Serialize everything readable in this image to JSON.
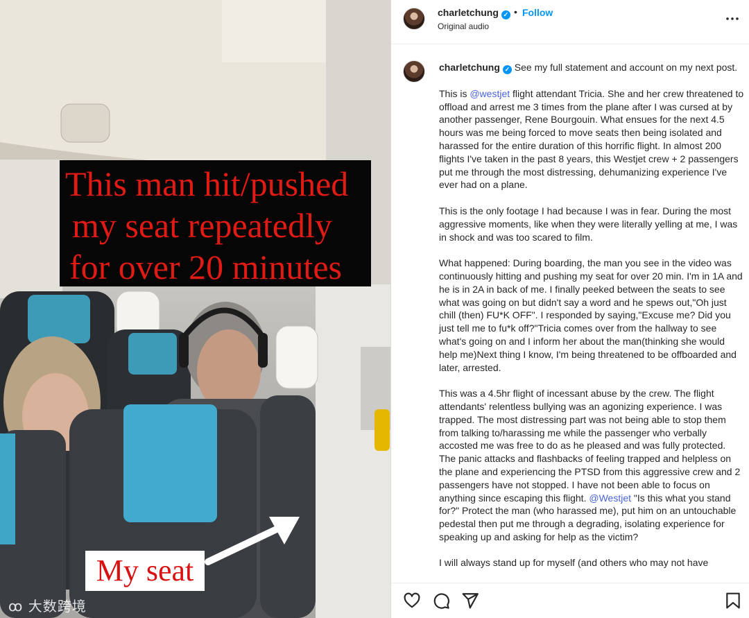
{
  "media": {
    "caption_lines": [
      "This man hit/pushed",
      "my seat repeatedly",
      "for over 20 minutes"
    ],
    "seat_label": "My seat",
    "watermark": "大数跨境"
  },
  "header": {
    "username": "charletchung",
    "dot": "•",
    "follow_label": "Follow",
    "audio_label": "Original audio"
  },
  "caption": {
    "username": "charletchung",
    "intro": "See my full statement and account on my next post.",
    "p1_a": "This is ",
    "p1_mention": "@westjet",
    "p1_b": " flight attendant Tricia. She and her crew threatened to offload and arrest me 3 times from the plane after I was cursed at by another passenger, Rene Bourgouin. What ensues for the next 4.5 hours was me being forced to move seats then being isolated and harassed for the entire duration of this horrific flight. In almost 200 flights I've taken in the past 8 years, this Westjet crew + 2 passengers put me through the most distressing, dehumanizing experience I've ever had on a plane.",
    "p2": "This is the only footage I had because I was in fear. During the most aggressive moments, like when they were literally yelling at me, I was in shock and was too scared to film.",
    "p3": "What happened: During boarding, the man you see in the video was continuously hitting and pushing my seat for over 20 min. I'm in 1A and he is in 2A in back of me. I finally peeked between the seats to see what was going on but didn't say a word and he spews out,\"Oh just chill (then) FU*K OFF\". I responded by saying,\"Excuse me? Did you just tell me to fu*k off?\"Tricia comes over from the hallway to see what's going on and I inform her about the man(thinking she would help me)Next thing I know, I'm being threatened to be offboarded and later, arrested.",
    "p4_a": "This was a 4.5hr flight of incessant abuse by the crew. The flight attendants' relentless bullying was an agonizing experience. I was trapped. The most distressing part was not being able to stop them from talking to/harassing me while the passenger who verbally accosted me was free to do as he pleased and was fully protected. The panic attacks and flashbacks of feeling trapped and helpless on the plane and experiencing the PTSD from this aggressive crew and 2 passengers have not stopped. I have not been able to focus on anything since escaping this flight. ",
    "p4_mention": "@Westjet",
    "p4_b": " \"Is this what you stand for?\" Protect the man (who harassed me), put him on an untouchable pedestal then put me through a degrading, isolating experience for speaking up and asking for help as the victim?",
    "p5": "I will always stand up for myself (and others who may not have"
  },
  "actions": {
    "icons": [
      "heart-icon",
      "comment-icon",
      "share-icon",
      "bookmark-icon"
    ]
  },
  "colors": {
    "accent_blue": "#0095f6",
    "mention_blue": "#4a62d8",
    "caption_red": "#e01a14",
    "text": "#262626"
  }
}
